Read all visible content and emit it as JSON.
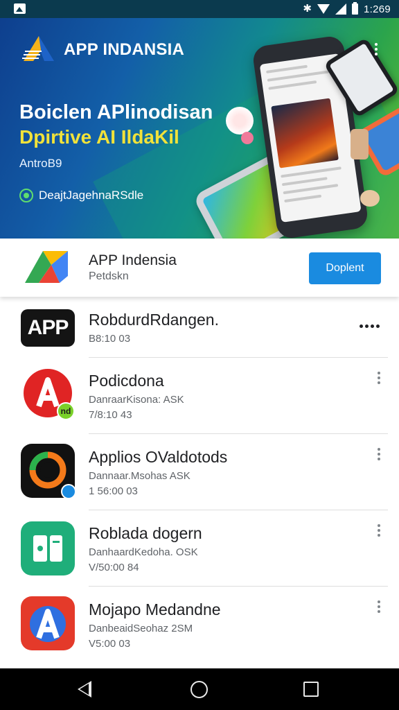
{
  "status_bar": {
    "time": "1:269"
  },
  "banner": {
    "brand": "APP INDANSIA",
    "headline_line1": "Boiclen APlinodisan",
    "headline_line2": "Dpirtive AI IldaKil",
    "subline": "AntroB9",
    "cta": "DeajtJagehnaRSdle"
  },
  "featured": {
    "title": "APP Indensia",
    "subtitle": "Petdskn",
    "install_label": "Doplent"
  },
  "list": [
    {
      "title": "RobdurdRdangen.",
      "subtitle": "",
      "meta": "B8:10 03",
      "icon": "app-text-icon",
      "badge": ""
    },
    {
      "title": "Podicdona",
      "subtitle": "DanraarKisona: ASK",
      "meta": "7/8:10 43",
      "icon": "letter-a-icon",
      "badge": "nd"
    },
    {
      "title": "Applios OValdotods",
      "subtitle": "Dannaar.Msohas ASK",
      "meta": "1 56:00 03",
      "icon": "chat-circle-icon",
      "badge": ""
    },
    {
      "title": "Roblada dogern",
      "subtitle": "DanhaardKedoha. OSK",
      "meta": "V/50:00 84",
      "icon": "document-icon",
      "badge": ""
    },
    {
      "title": "Mojapo Medandne",
      "subtitle": "DanbeaidSeohaz 2SM",
      "meta": "V5:00 03",
      "icon": "letter-a-blue-icon",
      "badge": ""
    }
  ],
  "colors": {
    "accent": "#1a8be0",
    "status_bar": "#0b3a4e",
    "nav_bar": "#000000",
    "headline_yellow": "#f1e23a"
  }
}
